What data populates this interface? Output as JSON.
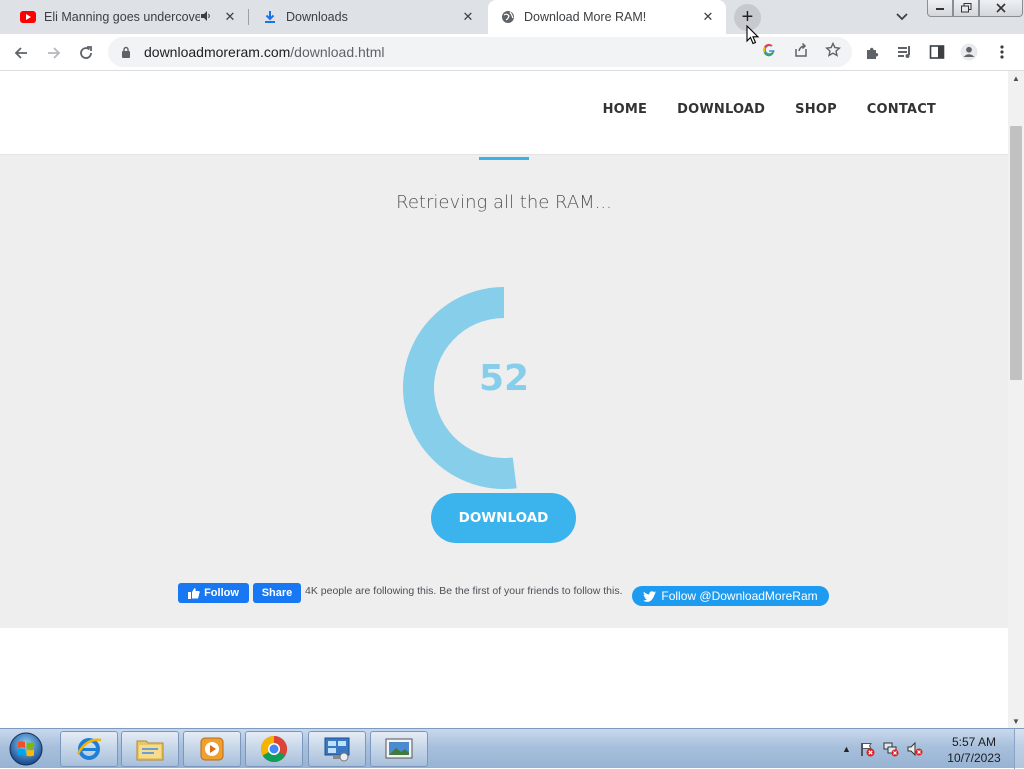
{
  "browser": {
    "tabs": [
      {
        "title": "Eli Manning goes undercover",
        "icon": "youtube-icon",
        "audio": true
      },
      {
        "title": "Downloads",
        "icon": "download-icon",
        "audio": false
      },
      {
        "title": "Download More RAM!",
        "icon": "globe-icon",
        "audio": false,
        "active": true
      }
    ],
    "new_tab_symbol": "+",
    "close_symbol": "✕",
    "address": {
      "domain": "downloadmoreram.com",
      "path": "/download.html"
    }
  },
  "site": {
    "nav": [
      "HOME",
      "DOWNLOAD",
      "SHOP",
      "CONTACT"
    ],
    "status_text": "Retrieving all the RAM...",
    "progress_value": "52",
    "progress_fraction": 0.52,
    "download_button": "DOWNLOAD",
    "facebook": {
      "follow_label": "Follow",
      "share_label": "Share",
      "text": "4K people are following this. Be the first of your friends to follow this."
    },
    "twitter": {
      "follow_label": "Follow @DownloadMoreRam"
    },
    "colors": {
      "accent": "#39b3e8",
      "gauge": "#87ceeb",
      "button": "#3bb4ee"
    }
  },
  "taskbar": {
    "apps": [
      "internet-explorer-icon",
      "windows-explorer-icon",
      "media-player-icon",
      "chrome-icon",
      "remote-desktop-icon",
      "photo-viewer-icon"
    ],
    "clock": {
      "time": "5:57 AM",
      "date": "10/7/2023"
    }
  }
}
